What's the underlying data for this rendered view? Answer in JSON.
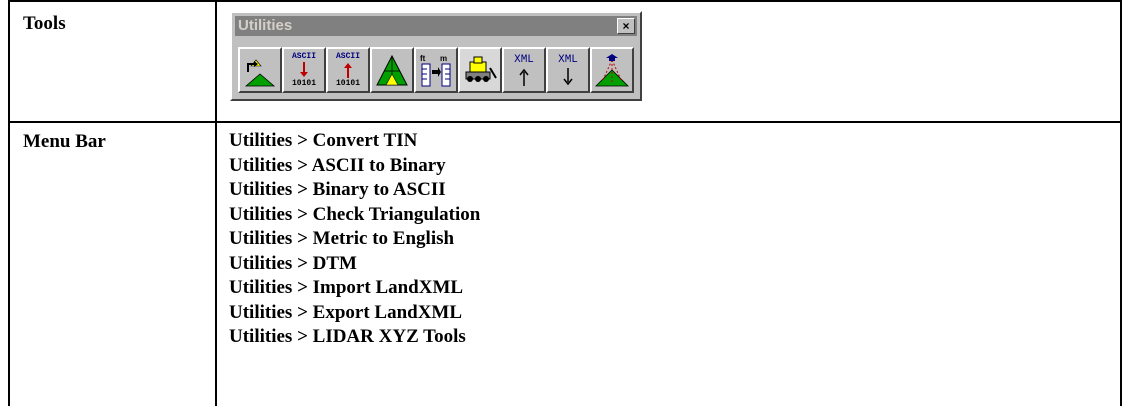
{
  "rows": [
    {
      "label": "Tools"
    },
    {
      "label": "Menu Bar"
    }
  ],
  "toolbar": {
    "title": "Utilities",
    "close_glyph": "×",
    "buttons": [
      {
        "name": "convert-tin-icon"
      },
      {
        "name": "ascii-to-binary-icon",
        "top_text": "ASCII",
        "bottom_text": "10101"
      },
      {
        "name": "binary-to-ascii-icon",
        "top_text": "ASCII",
        "bottom_text": "10101"
      },
      {
        "name": "check-triangulation-icon"
      },
      {
        "name": "metric-to-english-icon"
      },
      {
        "name": "dtm-icon"
      },
      {
        "name": "import-landxml-icon",
        "top_text": "XML"
      },
      {
        "name": "export-landxml-icon",
        "top_text": "XML"
      },
      {
        "name": "lidar-xyz-tools-icon"
      }
    ]
  },
  "menu_items": [
    "Utilities > Convert TIN",
    "Utilities > ASCII to Binary",
    "Utilities > Binary to ASCII",
    "Utilities > Check Triangulation",
    "Utilities > Metric to English",
    "Utilities > DTM",
    "Utilities > Import LandXML",
    "Utilities > Export LandXML",
    "Utilities > LIDAR XYZ Tools"
  ],
  "colors": {
    "toolbar_bg": "#c0c0c0",
    "titlebar_inactive": "#808080",
    "terrain_green": "#00a000",
    "arrow_red": "#c00000",
    "ascii_blue": "#000080"
  }
}
